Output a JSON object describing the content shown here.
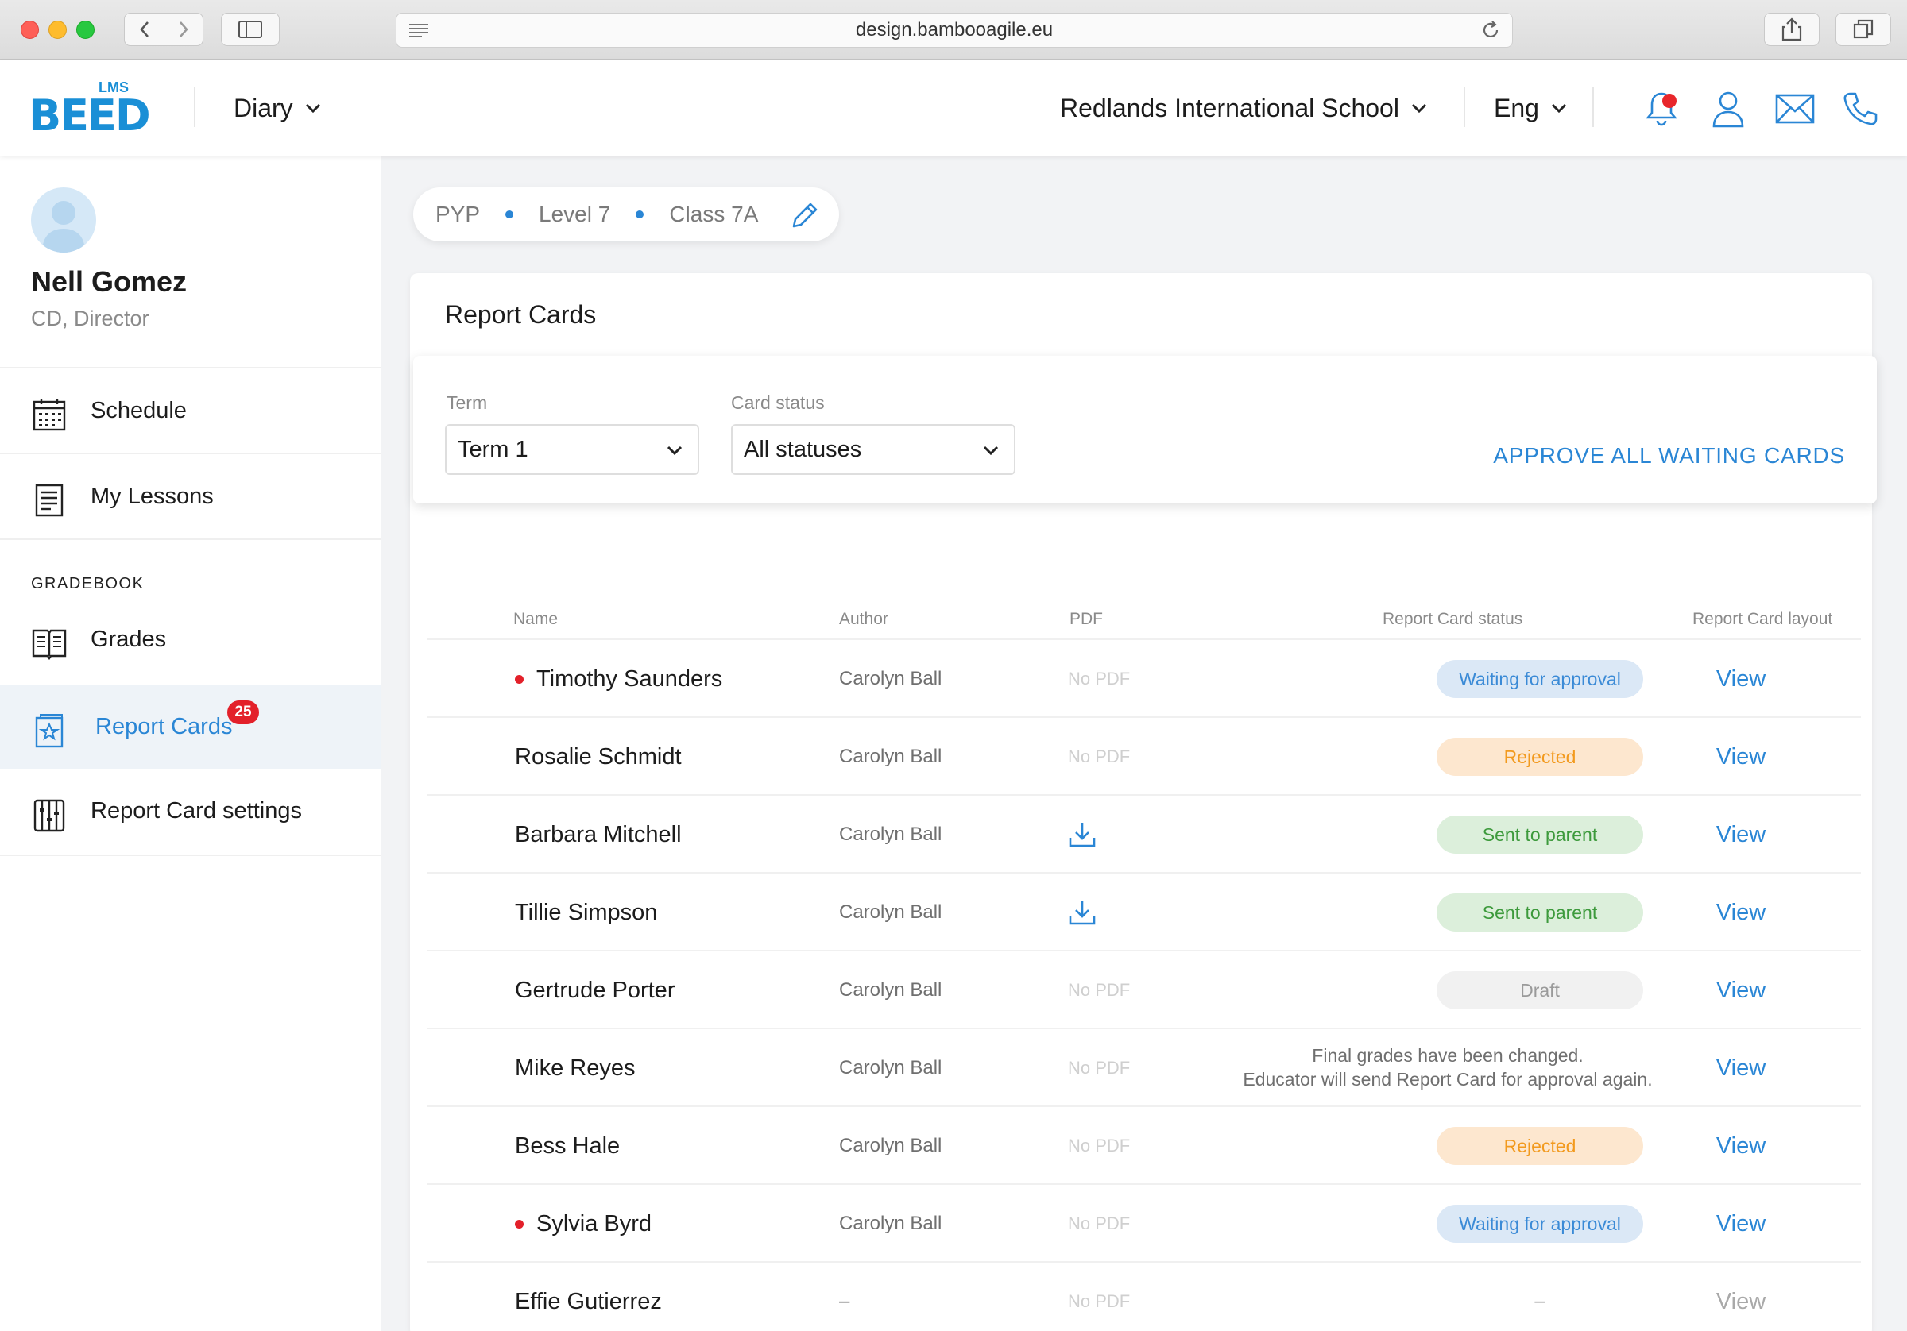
{
  "browser": {
    "url": "design.bambooagile.eu"
  },
  "header": {
    "logo_small": "LMS",
    "logo_word": "BEED",
    "module_dropdown": "Diary",
    "school_dropdown": "Redlands International School",
    "language_dropdown": "Eng"
  },
  "user": {
    "name": "Nell Gomez",
    "role": "CD, Director"
  },
  "sidebar": {
    "items": [
      {
        "label": "Schedule",
        "icon": "calendar-icon"
      },
      {
        "label": "My Lessons",
        "icon": "lessons-icon"
      },
      {
        "label": "Grades",
        "icon": "book-icon"
      },
      {
        "label": "Report Cards",
        "icon": "report-card-icon",
        "badge": "25",
        "active": true
      },
      {
        "label": "Report Card settings",
        "icon": "settings-sliders-icon"
      }
    ],
    "section_heading": "GRADEBOOK"
  },
  "breadcrumb": {
    "program": "PYP",
    "level": "Level 7",
    "class": "Class 7A"
  },
  "report_cards": {
    "title": "Report Cards",
    "filters": {
      "term_label": "Term",
      "term_value": "Term 1",
      "status_label": "Card status",
      "status_value": "All statuses"
    },
    "approve_all": "APPROVE ALL WAITING CARDS",
    "columns": {
      "name": "Name",
      "author": "Author",
      "pdf": "PDF",
      "status": "Report Card status",
      "layout": "Report Card layout"
    },
    "rows": [
      {
        "name": "Timothy Saunders",
        "author": "Carolyn Ball",
        "pdf": "No PDF",
        "status": "Waiting for approval",
        "view": "View"
      },
      {
        "name": "Rosalie Schmidt",
        "author": "Carolyn Ball",
        "pdf": "No PDF",
        "status": "Rejected",
        "view": "View"
      },
      {
        "name": "Barbara Mitchell",
        "author": "Carolyn Ball",
        "pdf": "",
        "status": "Sent to parent",
        "view": "View"
      },
      {
        "name": "Tillie Simpson",
        "author": "Carolyn Ball",
        "pdf": "",
        "status": "Sent to parent",
        "view": "View"
      },
      {
        "name": "Gertrude Porter",
        "author": "Carolyn Ball",
        "pdf": "No PDF",
        "status": "Draft",
        "view": "View"
      },
      {
        "name": "Mike Reyes",
        "author": "Carolyn Ball",
        "pdf": "No PDF",
        "status_note_1": "Final grades have been changed.",
        "status_note_2": "Educator will send Report Card for approval again.",
        "view": "View"
      },
      {
        "name": "Bess Hale",
        "author": "Carolyn Ball",
        "pdf": "No PDF",
        "status": "Rejected",
        "view": "View"
      },
      {
        "name": "Sylvia Byrd",
        "author": "Carolyn Ball",
        "pdf": "No PDF",
        "status": "Waiting for approval",
        "view": "View"
      },
      {
        "name": "Effie Gutierrez",
        "author": "–",
        "pdf": "No PDF",
        "status": "–",
        "view": "View"
      }
    ]
  },
  "colors": {
    "accent": "#2a86d5",
    "badge": "#e3202a",
    "waiting": "#dbe8f6",
    "rejected": "#fde7cf",
    "sent": "#dcefdb",
    "draft": "#f1f1f1"
  }
}
